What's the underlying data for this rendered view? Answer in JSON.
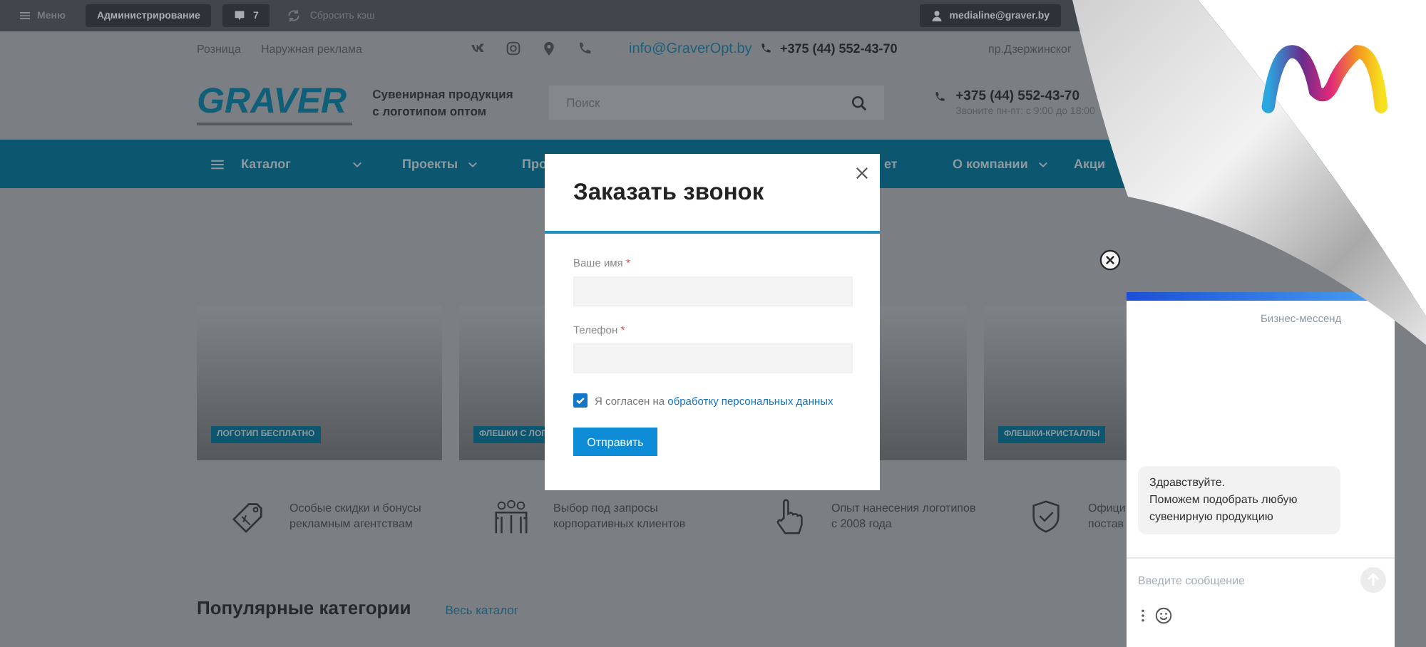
{
  "admin_bar": {
    "menu_label": "Меню",
    "admin_button": "Администрирование",
    "notifications_count": "7",
    "cache_button": "Сбросить кэш",
    "user_button": "medialine@graver.by"
  },
  "header": {
    "links": [
      "Розница",
      "Наружная реклама"
    ],
    "email": "info@GraverOpt.by",
    "phone_top": "+375 (44) 552-43-70",
    "address": "пр.Дзержинског",
    "logo": "GRAVER",
    "tagline": "Сувенирная продукция с логотипом оптом",
    "search": {
      "placeholder": "Поиск"
    },
    "phone": "+375 (44) 552-43-70",
    "hours": "Звоните пн-пт: с 9:00 до 18:00"
  },
  "nav": [
    {
      "label": "Каталог",
      "kind": "catalog",
      "dropdown": true
    },
    {
      "label": "Проекты",
      "kind": "link",
      "dropdown": true
    },
    {
      "label": "Про",
      "kind": "link",
      "dropdown": false
    },
    {
      "label": "ет",
      "kind": "link",
      "dropdown": false
    },
    {
      "label": "О компании",
      "kind": "link",
      "dropdown": true
    },
    {
      "label": "Акци",
      "kind": "link",
      "dropdown": false
    }
  ],
  "banners": [
    {
      "kind": "labeled",
      "label": "ЛОГОТИП БЕСПЛАТНО"
    },
    {
      "kind": "labeled",
      "label": "ФЛЕШКИ С ЛОГ"
    },
    {
      "kind": "plain"
    },
    {
      "kind": "labeled",
      "label": "ФЛЕШКИ-КРИСТАЛЛЫ"
    }
  ],
  "features": [
    {
      "kind": "tag",
      "text": "Особые скидки и бонусы\nрекламным агентствам"
    },
    {
      "kind": "people",
      "text": "Выбор под запросы\nкорпоративных клиентов"
    },
    {
      "kind": "hand",
      "text": "Опыт нанесения логотипов\nс 2008 года"
    },
    {
      "kind": "shield",
      "text": "Офици\nпостав"
    }
  ],
  "popular": {
    "title": "Популярные категории",
    "link": "Весь каталог"
  },
  "modal": {
    "title": "Заказать звонок",
    "fields": [
      {
        "label": "Ваше имя",
        "mark": "*"
      },
      {
        "label": "Телефон",
        "mark": "*"
      }
    ],
    "consent": {
      "checked": true,
      "text": "Я согласен на",
      "link": "обработку персональных данных"
    },
    "submit": "Отправить"
  },
  "chat": {
    "brand": "Бизнес-мессенд",
    "message": "Здравствуйте.\nПоможем подобрать любую\nсувенирную продукцию",
    "input": {
      "placeholder": "Введите сообщение"
    }
  }
}
